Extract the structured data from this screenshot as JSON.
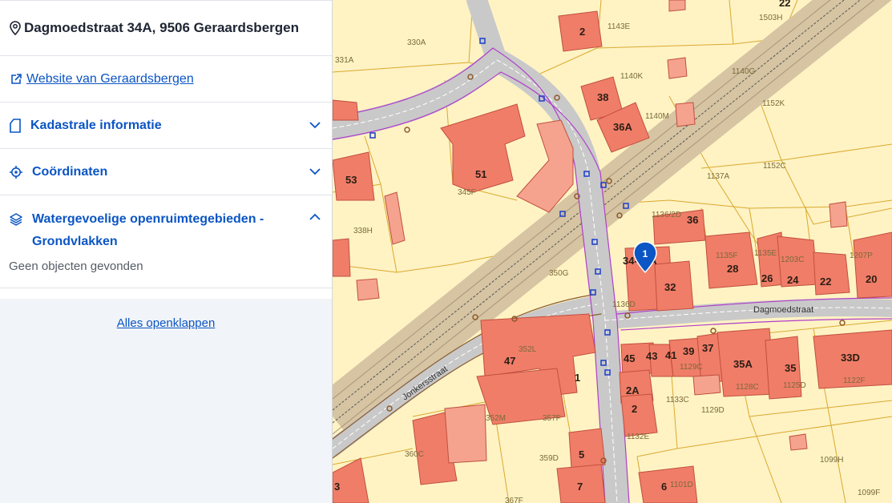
{
  "sidebar": {
    "address": "Dagmoedstraat 34A, 9506 Geraardsbergen",
    "website_link": "Website van Geraardsbergen",
    "sections": [
      {
        "title": "Kadastrale informatie",
        "open": false
      },
      {
        "title": "Coördinaten",
        "open": false
      },
      {
        "title_line1": "Watergevoelige openruimtegebieden -",
        "title_line2": "Grondvlakken",
        "open": true,
        "content": "Geen objecten gevonden"
      }
    ],
    "expand_all": "Alles openklappen"
  },
  "map": {
    "marker_label": "1",
    "streets": [
      "Dagmoedstraat",
      "Jonkersstraat"
    ],
    "building_numbers": [
      "22",
      "2",
      "38",
      "36A",
      "53",
      "51",
      "36",
      "34-34A",
      "32",
      "28",
      "26",
      "24",
      "22",
      "20",
      "47",
      "1",
      "45",
      "43",
      "41",
      "39",
      "37",
      "35A",
      "35",
      "33D",
      "2A",
      "2",
      "5",
      "7",
      "6",
      "3"
    ],
    "parcel_labels": [
      "1503H",
      "330A",
      "1143E",
      "331A",
      "1140G",
      "1140K",
      "1152K",
      "1140M",
      "1137A",
      "1152C",
      "345F",
      "338H",
      "1136/2D",
      "1135F",
      "1135E",
      "1203C",
      "1207P",
      "350G",
      "1136D",
      "352L",
      "1129C",
      "1128C",
      "1125D",
      "1122F",
      "1133C",
      "1129D",
      "352M",
      "357F",
      "1132E",
      "360C",
      "359D",
      "1099H",
      "1101D",
      "1099F",
      "367F"
    ]
  },
  "colors": {
    "link": "#0b55c4",
    "parcel": "#fff3c4",
    "building": "#f07d68",
    "road": "#c9c9c9",
    "rail": "#d6c4a2",
    "marker": "#0b55c4"
  }
}
